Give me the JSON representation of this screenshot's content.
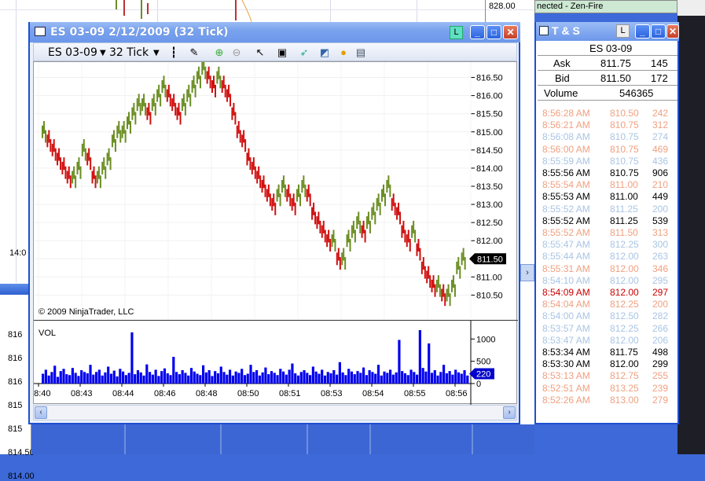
{
  "background_window": {
    "axis_top_label": "828.00",
    "time_label": "14:0",
    "left_axis_ticks": [
      "816",
      "816",
      "816",
      "815",
      "815",
      "814.50",
      "814.00"
    ]
  },
  "chart_window": {
    "title": "ES 03-09  2/12/2009 (32 Tick)",
    "link_badge": "L",
    "toolbar": {
      "instrument": "ES 03-09",
      "interval": "32 Tick",
      "icons": [
        "bars-type-icon",
        "pen-draw-icon",
        "zoom-in-icon",
        "zoom-out-icon",
        "pointer-icon",
        "properties-icon",
        "strategy-icon",
        "chart-style-icon",
        "indicator-icon",
        "data-box-icon"
      ]
    },
    "copyright": "© 2009 NinjaTrader, LLC",
    "volume_label": "VOL",
    "last_price_marker": "811.50",
    "last_volume_marker": "220"
  },
  "chart_data": [
    {
      "type": "line",
      "title": "",
      "x_labels": [
        "08:40",
        "08:43",
        "08:44",
        "08:46",
        "08:48",
        "08:50",
        "08:51",
        "08:53",
        "08:54",
        "08:55",
        "08:56"
      ],
      "y_ticks": [
        "816.50",
        "816.00",
        "815.50",
        "815.00",
        "814.50",
        "814.00",
        "813.50",
        "813.00",
        "812.50",
        "812.00",
        "811.50",
        "811.00",
        "810.50"
      ],
      "ylim": [
        810.25,
        816.75
      ],
      "series": [
        {
          "values": [
            815.0,
            814.75,
            814.5,
            814.25,
            814.0,
            813.75,
            813.75,
            814.0,
            814.5,
            814.25,
            813.75,
            813.75,
            814.0,
            814.25,
            814.75,
            815.0,
            815.0,
            815.25,
            815.5,
            815.75,
            815.75,
            815.5,
            815.75,
            816.0,
            816.25,
            816.0,
            815.75,
            815.5,
            815.75,
            816.0,
            816.25,
            816.5,
            816.75,
            816.5,
            816.25,
            816.5,
            816.25,
            816.0,
            815.5,
            815.0,
            814.75,
            814.25,
            814.0,
            813.75,
            813.5,
            813.25,
            813.0,
            813.25,
            813.5,
            813.25,
            813.0,
            813.25,
            813.5,
            813.25,
            812.75,
            812.5,
            812.25,
            812.0,
            812.0,
            811.5,
            811.5,
            812.0,
            812.25,
            812.5,
            812.25,
            812.5,
            812.75,
            813.0,
            813.25,
            813.5,
            813.0,
            812.75,
            812.25,
            812.0,
            812.25,
            811.75,
            811.25,
            811.0,
            810.75,
            810.75,
            810.5,
            810.5,
            810.75,
            811.25,
            811.5
          ]
        }
      ]
    },
    {
      "type": "bar",
      "title": "VOL",
      "y_ticks": [
        "1000",
        "500",
        "0"
      ],
      "ylim": [
        0,
        1200
      ],
      "series": [
        {
          "name": "VOL",
          "values": [
            220,
            310,
            180,
            260,
            400,
            150,
            280,
            330,
            210,
            190,
            350,
            240,
            170,
            300,
            260,
            230,
            420,
            200,
            260,
            310,
            180,
            250,
            380,
            220,
            290,
            160,
            330,
            270,
            190,
            240,
            1150,
            210,
            300,
            250,
            180,
            430,
            260,
            200,
            310,
            170,
            280,
            340,
            230,
            190,
            600,
            260,
            210,
            300,
            240,
            180,
            350,
            270,
            220,
            190,
            410,
            250,
            300,
            170,
            280,
            230,
            380,
            260,
            200,
            310,
            180,
            270,
            240,
            330,
            190,
            220,
            420,
            260,
            300,
            180,
            250,
            360,
            210,
            280,
            240,
            190,
            330,
            270,
            200,
            310,
            450,
            230,
            180,
            260,
            300,
            240,
            190,
            380,
            270,
            220,
            310,
            180,
            260,
            230,
            300,
            200,
            480,
            250,
            190,
            330,
            270,
            210,
            280,
            240,
            360,
            190,
            300,
            260,
            220,
            420,
            180,
            270,
            240,
            310,
            200,
            250,
            980,
            280,
            230,
            190,
            310,
            260,
            200,
            1200,
            350,
            270,
            900,
            240,
            300,
            180,
            260,
            420,
            230,
            280,
            200,
            310,
            250,
            220,
            300,
            180
          ]
        }
      ]
    }
  ],
  "time_and_sales": {
    "title": "T & S",
    "link_badge": "L",
    "instrument": "ES 03-09",
    "ask_label": "Ask",
    "ask_price": "811.75",
    "ask_size": "145",
    "bid_label": "Bid",
    "bid_price": "811.50",
    "bid_size": "172",
    "volume_label": "Volume",
    "volume_value": "546365",
    "colors": {
      "above_ask": "#f4a582",
      "below_bid": "#a9c4e4",
      "at_ask": "#000000",
      "red": "#cc0000"
    },
    "trades": [
      {
        "time": "8:56:28 AM",
        "price": "810.50",
        "size": "242",
        "color": "#f0a080"
      },
      {
        "time": "8:56:21 AM",
        "price": "810.75",
        "size": "312",
        "color": "#f0a080"
      },
      {
        "time": "8:56:08 AM",
        "price": "810.75",
        "size": "274",
        "color": "#a9c4e4"
      },
      {
        "time": "8:56:00 AM",
        "price": "810.75",
        "size": "469",
        "color": "#f0a080"
      },
      {
        "time": "8:55:59 AM",
        "price": "810.75",
        "size": "436",
        "color": "#a9c4e4"
      },
      {
        "time": "8:55:56 AM",
        "price": "810.75",
        "size": "906",
        "color": "#000000"
      },
      {
        "time": "8:55:54 AM",
        "price": "811.00",
        "size": "210",
        "color": "#f0a080"
      },
      {
        "time": "8:55:53 AM",
        "price": "811.00",
        "size": "449",
        "color": "#000000"
      },
      {
        "time": "8:55:52 AM",
        "price": "811.25",
        "size": "200",
        "color": "#a9c4e4"
      },
      {
        "time": "8:55:52 AM",
        "price": "811.25",
        "size": "539",
        "color": "#000000"
      },
      {
        "time": "8:55:52 AM",
        "price": "811.50",
        "size": "313",
        "color": "#f0a080"
      },
      {
        "time": "8:55:47 AM",
        "price": "812.25",
        "size": "300",
        "color": "#a9c4e4"
      },
      {
        "time": "8:55:44 AM",
        "price": "812.00",
        "size": "263",
        "color": "#a9c4e4"
      },
      {
        "time": "8:55:31 AM",
        "price": "812.00",
        "size": "346",
        "color": "#f0a080"
      },
      {
        "time": "8:54:10 AM",
        "price": "812.00",
        "size": "295",
        "color": "#a9c4e4"
      },
      {
        "time": "8:54:09 AM",
        "price": "812.00",
        "size": "297",
        "color": "#cc0000"
      },
      {
        "time": "8:54:04 AM",
        "price": "812.25",
        "size": "200",
        "color": "#f0a080"
      },
      {
        "time": "8:54:00 AM",
        "price": "812.50",
        "size": "282",
        "color": "#a9c4e4"
      },
      {
        "time": "8:53:57 AM",
        "price": "812.25",
        "size": "266",
        "color": "#a9c4e4"
      },
      {
        "time": "8:53:47 AM",
        "price": "812.00",
        "size": "206",
        "color": "#a9c4e4"
      },
      {
        "time": "8:53:34 AM",
        "price": "811.75",
        "size": "498",
        "color": "#000000"
      },
      {
        "time": "8:53:30 AM",
        "price": "812.00",
        "size": "299",
        "color": "#000000"
      },
      {
        "time": "8:53:13 AM",
        "price": "812.75",
        "size": "255",
        "color": "#f0a080"
      },
      {
        "time": "8:52:51 AM",
        "price": "813.25",
        "size": "239",
        "color": "#f0a080"
      },
      {
        "time": "8:52:26 AM",
        "price": "813.00",
        "size": "279",
        "color": "#f0a080"
      }
    ]
  },
  "status": {
    "connection": "nected - Zen-Fire"
  }
}
